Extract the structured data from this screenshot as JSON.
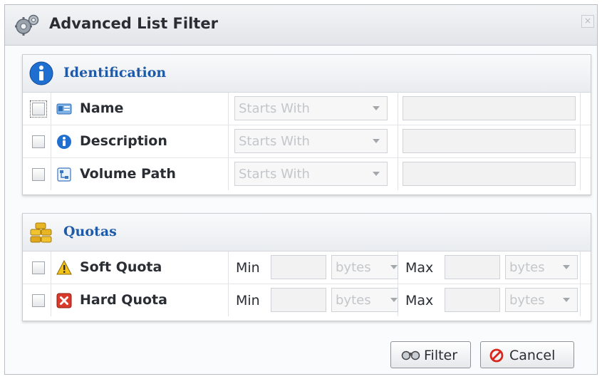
{
  "dialog": {
    "title": "Advanced List Filter",
    "close_glyph": "×"
  },
  "identification": {
    "title": "Identification",
    "rows": [
      {
        "label": "Name",
        "icon": "name-card-icon",
        "operator": "Starts With"
      },
      {
        "label": "Description",
        "icon": "info-icon",
        "operator": "Starts With"
      },
      {
        "label": "Volume Path",
        "icon": "volume-path-icon",
        "operator": "Starts With"
      }
    ]
  },
  "quotas": {
    "title": "Quotas",
    "rows": [
      {
        "label": "Soft Quota",
        "icon": "warning-icon",
        "min_label": "Min",
        "min_unit": "bytes",
        "max_label": "Max",
        "max_unit": "bytes"
      },
      {
        "label": "Hard Quota",
        "icon": "error-icon",
        "min_label": "Min",
        "min_unit": "bytes",
        "max_label": "Max",
        "max_unit": "bytes"
      }
    ]
  },
  "buttons": {
    "filter": "Filter",
    "cancel": "Cancel"
  },
  "colors": {
    "section_title": "#1f5aa8",
    "info_blue": "#1e6fd0",
    "warning_yellow": "#f2c21a",
    "error_red": "#d93a2b"
  }
}
